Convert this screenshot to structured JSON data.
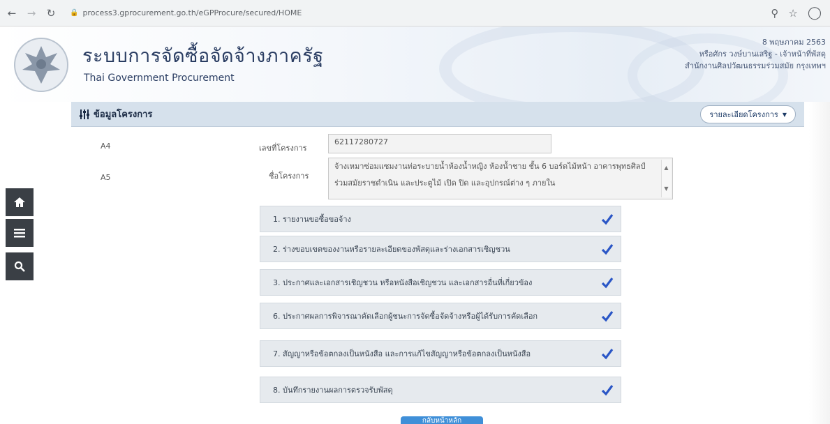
{
  "browser": {
    "url": "process3.gprocurement.go.th/eGPProcure/secured/HOME",
    "icons": [
      "back-icon",
      "forward-icon",
      "reload-icon",
      "lock-icon",
      "zoom-icon",
      "star-icon",
      "profile-icon"
    ]
  },
  "header": {
    "title": "ระบบการจัดซื้อจัดจ้างภาครัฐ",
    "subtitle": "Thai Government Procurement",
    "date": "8 พฤษภาคม 2563",
    "user_name": "หรือศักร วงษ์บานเสริฐ - เจ้าหน้าที่พัสดุ",
    "agency": "สำนักงานศิลปวัฒนธรรมร่วมสมัย กรุงเทพฯ"
  },
  "section": {
    "title": "ข้อมูลโครงการ",
    "detail_button": "รายละเอียดโครงการ"
  },
  "fields": [
    {
      "code": "A4",
      "label": "เลขที่โครงการ",
      "value": "62117280727"
    },
    {
      "code": "A5",
      "label": "ชื่อโครงการ",
      "value": "จ้างเหมาซ่อมแซมงานท่อระบายน้ำห้องน้ำหญิง ห้องน้ำชาย ชั้น 6 บอร์ดไม้หน้า อาคารพุทธศิลป์ร่วมสมัยราชดำเนิน และประตูไม้ เปิด ปิด และอุปกรณ์ต่าง ๆ ภายใน"
    }
  ],
  "steps": [
    {
      "label": "1. รายงานขอซื้อขอจ้าง",
      "done": true
    },
    {
      "label": "2. ร่างขอบเขตของงานหรือรายละเอียดของพัสดุและร่างเอกสารเชิญชวน",
      "done": true
    },
    {
      "label": "3. ประกาศและเอกสารเชิญชวน หรือหนังสือเชิญชวน และเอกสารอื่นที่เกี่ยวข้อง",
      "done": true
    },
    {
      "label": "6. ประกาศผลการพิจารณาคัดเลือกผู้ชนะการจัดซื้อจัดจ้างหรือผู้ได้รับการคัดเลือก",
      "done": true
    },
    {
      "label": "7. สัญญาหรือข้อตกลงเป็นหนังสือ และการแก้ไขสัญญาหรือข้อตกลงเป็นหนังสือ",
      "done": true
    },
    {
      "label": "8. บันทึกรายงานผลการตรวจรับพัสดุ",
      "done": true
    }
  ],
  "side_nav": [
    "home-icon",
    "menu-icon",
    "search-icon"
  ],
  "bottom_button": "กลับหน้าหลัก",
  "colors": {
    "accent_check": "#2a56c6",
    "section_bar": "#d6e1ec",
    "side_nav": "#3a3f45",
    "title_text": "#2a3d62"
  }
}
